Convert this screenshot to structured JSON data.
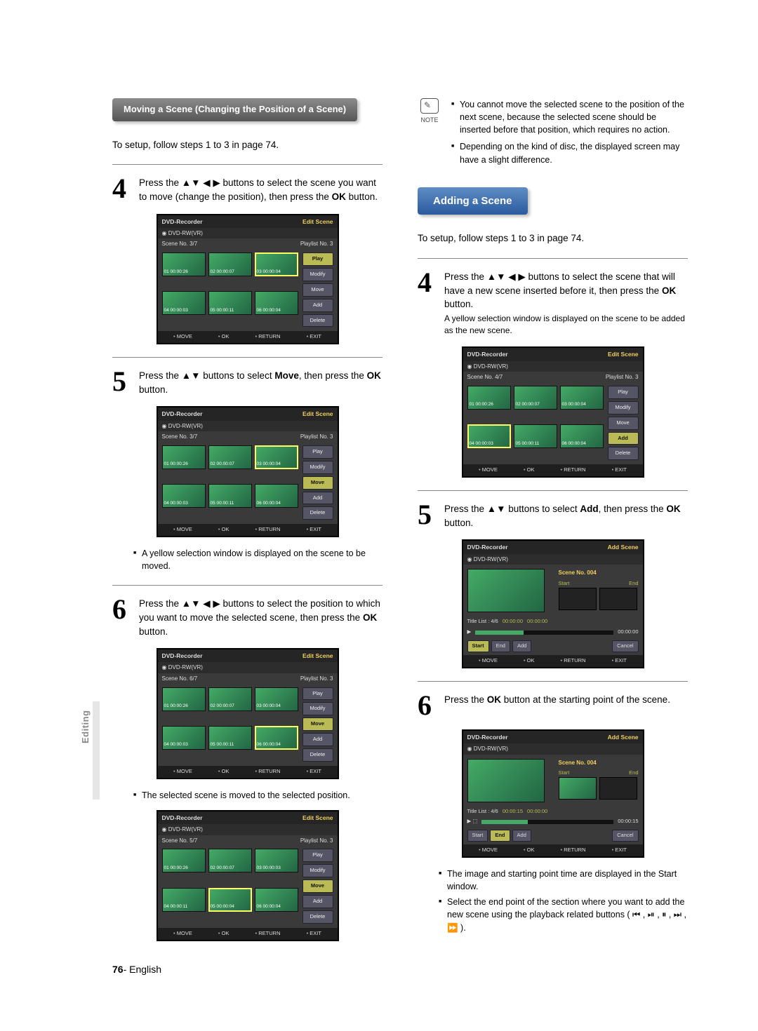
{
  "section_moving_title": "Moving a Scene (Changing the Position of a Scene)",
  "section_adding_title": "Adding a Scene",
  "setup_line": "To setup, follow steps 1 to 3 in page 74.",
  "side_label": "Editing",
  "footer_page": "76",
  "footer_lang": "- English",
  "note_label": "NOTE",
  "notes": [
    "You cannot move the selected scene to the position of the next scene, because the selected scene should be inserted before that position, which requires no action.",
    "Depending on the kind of disc, the displayed screen may have a slight difference."
  ],
  "left_steps": {
    "s4": {
      "num": "4",
      "body_a": "Press the ",
      "body_b": "▲▼ ◀ ▶ buttons to select the scene you want to move (change the position), then press the ",
      "body_c": "OK",
      "body_d": " button."
    },
    "s5": {
      "num": "5",
      "body_a": "Press the ",
      "body_b": "▲▼ buttons to select ",
      "body_c": "Move",
      "body_d": ", then press the ",
      "body_e": "OK",
      "body_f": " button."
    },
    "s5_sub": "A yellow selection window is displayed on the scene to be moved.",
    "s6": {
      "num": "6",
      "body_a": "Press the ",
      "body_b": "▲▼ ◀ ▶ buttons to select the position to which you want to move the selected scene, then press the ",
      "body_c": "OK",
      "body_d": " button."
    },
    "s6_sub": "The selected scene is moved to the selected position."
  },
  "right_steps": {
    "s4": {
      "num": "4",
      "body_a": "Press the ",
      "body_b": "▲▼ ◀ ▶ buttons to select the scene that will have a new scene inserted before it, then press the ",
      "body_c": "OK",
      "body_d": " button."
    },
    "s4_sub": "A yellow selection window is displayed on the scene to be added as the new scene.",
    "s5": {
      "num": "5",
      "body_a": "Press the ",
      "body_b": "▲▼ buttons to select ",
      "body_c": "Add",
      "body_d": ", then press the ",
      "body_e": "OK",
      "body_f": " button."
    },
    "s6": {
      "num": "6",
      "body_a": "Press the ",
      "body_b": "OK",
      "body_c": " button at the starting point of the scene."
    },
    "btm_bullets": [
      "The image and starting point time are displayed in the Start window.",
      "Select the end point of the section where you want to add the new scene using the playback related buttons ( ⏮ , ⏯ , ⏸ , ⏭ , ⏩ )."
    ]
  },
  "screen": {
    "recorder": "DVD-Recorder",
    "editScene": "Edit Scene",
    "addScene": "Add Scene",
    "disc": "DVD-RW(VR)",
    "sceneNoLabel": "Scene No.",
    "playlistNo": "Playlist No. 3",
    "btns": {
      "play": "Play",
      "modify": "Modify",
      "move": "Move",
      "add": "Add",
      "delete": "Delete"
    },
    "ftr": {
      "move": "MOVE",
      "ok": "OK",
      "return": "RETURN",
      "exit": "EXIT"
    },
    "thumbs37": [
      {
        "id": "01",
        "t": "00:00:26"
      },
      {
        "id": "02",
        "t": "00:00:07"
      },
      {
        "id": "03",
        "t": "00:00:04"
      },
      {
        "id": "04",
        "t": "00:00:03"
      },
      {
        "id": "05",
        "t": "00:00:11"
      },
      {
        "id": "06",
        "t": "00:00:04"
      }
    ],
    "thumbs67": [
      {
        "id": "01",
        "t": "00:00:26"
      },
      {
        "id": "02",
        "t": "00:00:07"
      },
      {
        "id": "03",
        "t": "00:00:04"
      },
      {
        "id": "04",
        "t": "00:00:03"
      },
      {
        "id": "05",
        "t": "00:00:11"
      },
      {
        "id": "06",
        "t": "00:00:04"
      }
    ],
    "thumbs57": [
      {
        "id": "01",
        "t": "00:00:26"
      },
      {
        "id": "02",
        "t": "00:00:07"
      },
      {
        "id": "03",
        "t": "00:00:03"
      },
      {
        "id": "04",
        "t": "00:00:11"
      },
      {
        "id": "05",
        "t": "00:00:04"
      },
      {
        "id": "06",
        "t": "00:00:04"
      }
    ],
    "sc37": "3/7",
    "sc67": "6/7",
    "sc57": "5/7",
    "sc47": "4/7",
    "addScreen": {
      "sceneNo": "Scene No. 004",
      "start": "Start",
      "end": "End",
      "titleList": "Title List : 4/6",
      "t1": "00:00:15",
      "t2": "00:00:00",
      "dur": "00:00:00",
      "dur2": "00:00:15",
      "t_start": "00:00:15",
      "t_end": "00:00:00",
      "cancel": "Cancel"
    }
  }
}
